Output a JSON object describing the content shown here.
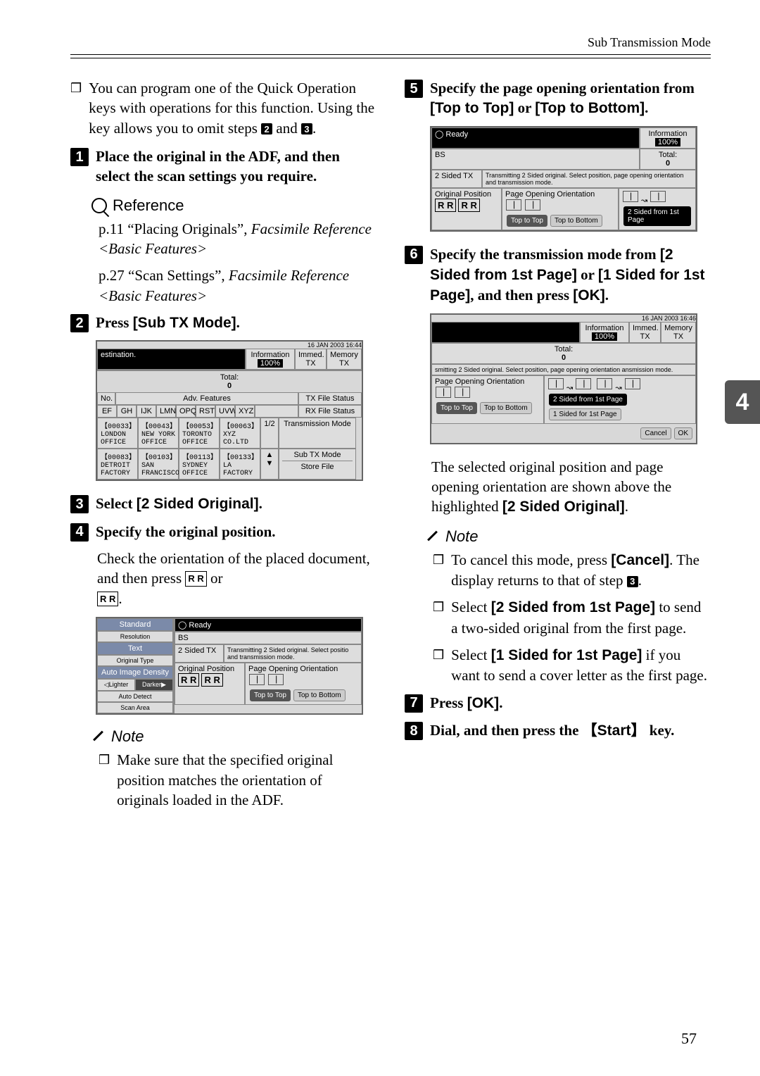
{
  "page": {
    "header": "Sub Transmission Mode",
    "number": "57",
    "thumb": "4"
  },
  "left": {
    "intro_bullet": "You can program one of the Quick Operation keys with operations for this function. Using the key allows you to omit steps ",
    "intro_mid": " and ",
    "intro_end": ".",
    "step1_text": "Place the original in the ADF, and then select the scan settings you require.",
    "reference_label": "Reference",
    "ref1_a": "p.11 “Placing Originals”, ",
    "ref1_b": "Facsimile Reference <Basic Features>",
    "ref2_a": "p.27 “Scan Settings”, ",
    "ref2_b": "Facsimile Reference <Basic Features>",
    "step2_pre": "Press ",
    "step2_ui": "[Sub TX Mode]",
    "step2_post": ".",
    "step3_pre": "Select ",
    "step3_ui": "[2 Sided Original]",
    "step3_post": ".",
    "step4_text": "Specify the original position.",
    "step4_body_a": "Check the orientation of the placed document, and then press ",
    "step4_body_b": " or ",
    "step4_body_c": ".",
    "note_label": "Note",
    "note4": "Make sure that the specified original position matches the orientation of originals loaded in the ADF."
  },
  "right": {
    "step5_pre": "Specify the page opening orientation from ",
    "step5_u1": "[Top to Top]",
    "step5_mid": " or ",
    "step5_u2": "[Top to Bottom]",
    "step5_post": ".",
    "step6_pre": "Specify the transmission mode from ",
    "step6_u1": "[2 Sided from 1st Page]",
    "step6_mid1": " or ",
    "step6_u2": "[1 Sided for 1st Page]",
    "step6_mid2": ", and then press ",
    "step6_u3": "[OK]",
    "step6_post": ".",
    "after6_a": "The selected original position and page opening orientation are shown above the highlighted ",
    "after6_ui": "[2 Sided Original]",
    "after6_b": ".",
    "note_label": "Note",
    "nb1_a": "To cancel this mode, press ",
    "nb1_ui": "[Cancel]",
    "nb1_b": ". The display returns to that of step ",
    "nb1_c": ".",
    "nb2_a": "Select ",
    "nb2_ui": "[2 Sided from 1st Page]",
    "nb2_b": " to send a two-sided original from the first page.",
    "nb3_a": "Select ",
    "nb3_ui": "[1 Sided for 1st Page]",
    "nb3_b": " if you want to send a cover letter as the first page.",
    "step7_pre": "Press ",
    "step7_ui": "[OK]",
    "step7_post": ".",
    "step8_pre": "Dial, and then press the ",
    "step8_key": "Start",
    "step8_post": " key."
  },
  "screens": {
    "s2": {
      "time": "16 JAN 2003 16:44",
      "info": "Information",
      "pct": "100%",
      "dest_label": "estination.",
      "immed": "Immed. TX",
      "memory": "Memory TX",
      "total": "Total:",
      "total_n": "0",
      "no": "No.",
      "adv": "Adv. Features",
      "txfile": "TX File Status",
      "rxfile": "RX File Status",
      "tabs": [
        "EF",
        "GH",
        "IJK",
        "LMN",
        "OPQ",
        "RST",
        "UVW",
        "XYZ"
      ],
      "grid": [
        [
          "【00033】",
          "LONDON OFFICE"
        ],
        [
          "【00043】",
          "NEW YORK OFFICE"
        ],
        [
          "【00053】",
          "TORONTO OFFICE"
        ],
        [
          "【00063】",
          "XYZ CO.LTD"
        ],
        [
          "【00083】",
          "DETROIT FACTORY"
        ],
        [
          "【00103】",
          "SAN FRANCISCO"
        ],
        [
          "【00113】",
          "SYDNEY OFFICE"
        ],
        [
          "【00133】",
          "LA FACTORY"
        ]
      ],
      "page": "1/2",
      "transm": "Transmission Mode",
      "subtx": "Sub TX Mode",
      "store": "Store File"
    },
    "s4": {
      "side": [
        "Standard",
        "Resolution",
        "Text",
        "Original Type",
        "Auto Image Density",
        "Lighter",
        "Darker",
        "Auto Detect",
        "Scan Area"
      ],
      "ready": "Ready",
      "bs": "BS",
      "row2s": "2 Sided TX",
      "row2msg": "Transmitting 2 Sided original. Select positio and transmission mode.",
      "orig": "Original Position",
      "open": "Page Opening Orientation",
      "t2t": "Top to Top",
      "t2b": "Top to Bottom"
    },
    "s5": {
      "ready": "Ready",
      "info": "Information",
      "pct": "100%",
      "bs": "BS",
      "total": "Total:",
      "total_n": "0",
      "row2s": "2 Sided TX",
      "row2msg": "Transmitting 2 Sided original. Select position, page opening orientation and transmission mode.",
      "orig": "Original Position",
      "open": "Page Opening Orientation",
      "t2t": "Top to Top",
      "t2b": "Top to Bottom",
      "right": "2 Sided from 1st Page"
    },
    "s6": {
      "time": "16 JAN 2003 16:46",
      "info": "Information",
      "pct": "100%",
      "immed": "Immed. TX",
      "memory": "Memory TX",
      "total": "Total:",
      "total_n": "0",
      "msg": "smitting 2 Sided original. Select position, page opening orientation ansmission mode.",
      "open": "Page Opening Orientation",
      "t2t": "Top to Top",
      "t2b": "Top to Bottom",
      "from": "2 Sided from 1st Page",
      "for1": "1 Sided for 1st Page",
      "cancel": "Cancel",
      "ok": "OK"
    }
  }
}
